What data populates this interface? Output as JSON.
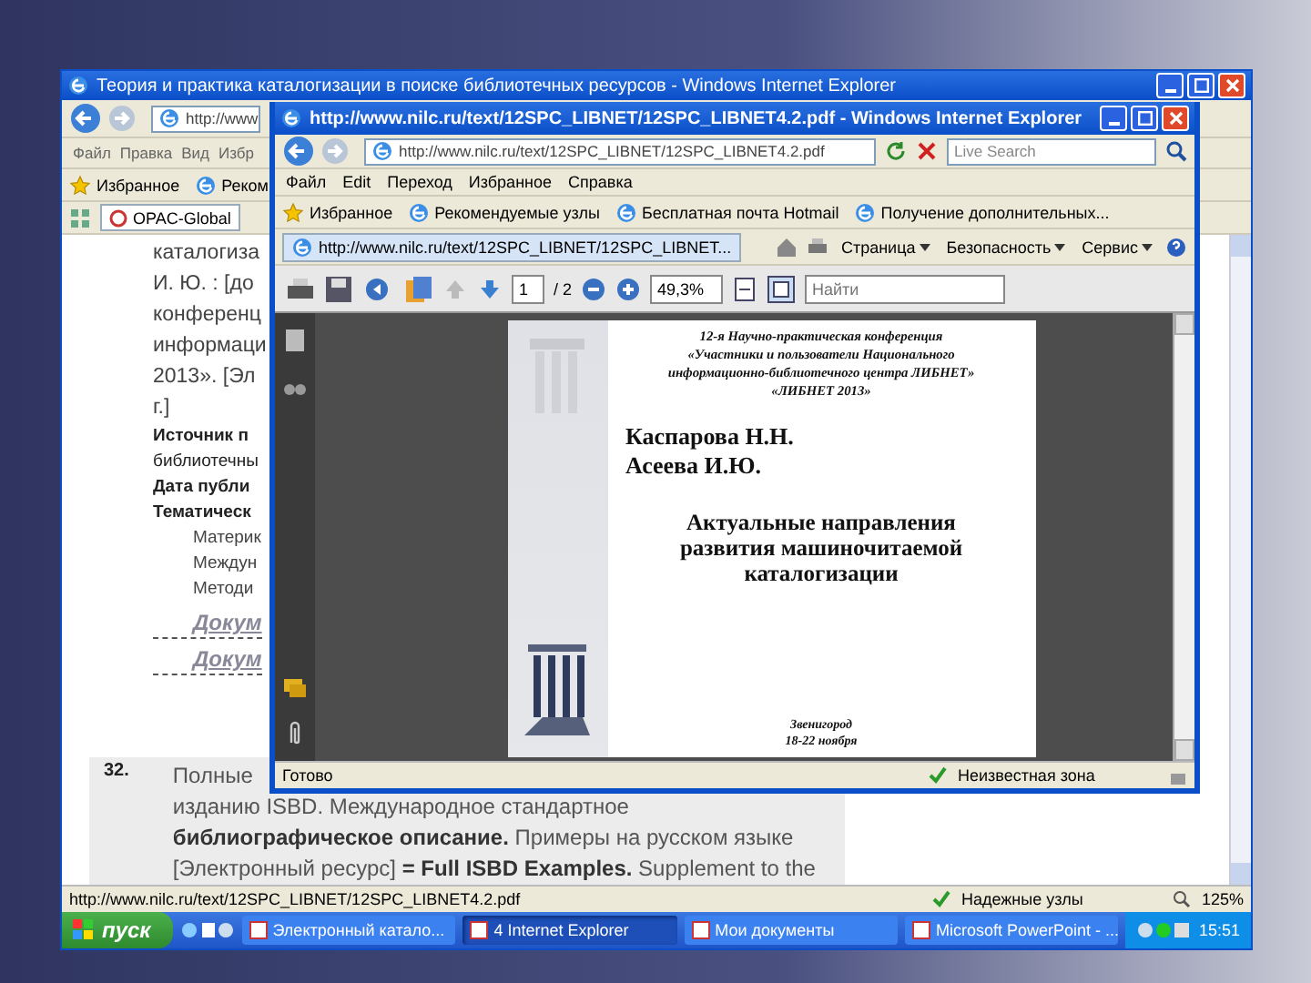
{
  "back_window": {
    "title": "Теория и практика каталогизации в поиске библиотечных ресурсов - Windows Internet Explorer",
    "address": "http://www",
    "menu": [
      "Файл",
      "Правка",
      "Вид",
      "Избр"
    ],
    "favorites": [
      "Избранное",
      "Реком"
    ],
    "tab": "OPAC-Global",
    "content": {
      "fragments": [
        {
          "kind": "large",
          "text": "каталогиза"
        },
        {
          "kind": "large",
          "text": "И. Ю. : [до"
        },
        {
          "kind": "large",
          "text": "конференц"
        },
        {
          "kind": "large",
          "text": "информаци"
        },
        {
          "kind": "large",
          "text": "2013». [Эл"
        },
        {
          "kind": "large",
          "text": "г.]"
        },
        {
          "kind": "bold",
          "text": "Источник п"
        },
        {
          "kind": "plain",
          "text": "библиотечны"
        },
        {
          "kind": "bold",
          "text": "Дата публи"
        },
        {
          "kind": "bold",
          "text": "Тематическ"
        },
        {
          "kind": "indent",
          "text": "Материк"
        },
        {
          "kind": "indent",
          "text": "Междун"
        },
        {
          "kind": "indent",
          "text": "Методи"
        },
        {
          "kind": "link",
          "text": "Докум"
        },
        {
          "kind": "link",
          "text": "Докум"
        }
      ],
      "entry_number": "32.",
      "entry_lines": [
        "Полные",
        "изданию ISBD. Международное стандартное",
        "**библиографическое описание.** Примеры на русском языке",
        "[Электронный ресурс] **= Full ISBD Examples.** Supplement to the"
      ]
    },
    "status": {
      "url": "http://www.nilc.ru/text/12SPC_LIBNET/12SPC_LIBNET4.2.pdf",
      "zone": "Надежные узлы",
      "zoom": "125%"
    }
  },
  "front_window": {
    "title": "http://www.nilc.ru/text/12SPC_LIBNET/12SPC_LIBNET4.2.pdf - Windows Internet Explorer",
    "address": "http://www.nilc.ru/text/12SPC_LIBNET/12SPC_LIBNET4.2.pdf",
    "search_placeholder": "Live Search",
    "menu": [
      "Файл",
      "Edit",
      "Переход",
      "Избранное",
      "Справка"
    ],
    "favorites": [
      "Избранное",
      "Рекомендуемые узлы",
      "Бесплатная почта Hotmail",
      "Получение дополнительных..."
    ],
    "tab": "http://www.nilc.ru/text/12SPC_LIBNET/12SPC_LIBNET...",
    "commands": [
      "Страница",
      "Безопасность",
      "Сервис"
    ],
    "pdf_toolbar": {
      "page": "1",
      "page_count": "/ 2",
      "zoom": "49,3%",
      "find_placeholder": "Найти"
    },
    "document": {
      "header_lines": [
        "12-я Научно-практическая конференция",
        "«Участники и пользователи Национального",
        "информационно-библиотечного центра ЛИБНЕТ»",
        "«ЛИБНЕТ 2013»"
      ],
      "authors": [
        "Каспарова Н.Н.",
        "Асеева И.Ю."
      ],
      "title_lines": [
        "Актуальные направления",
        "развития машиночитаемой",
        "каталогизации"
      ],
      "place": "Звенигород",
      "dates": "18-22 ноября"
    },
    "status": {
      "text": "Готово",
      "zone": "Неизвестная зона"
    }
  },
  "taskbar": {
    "start": "пуск",
    "tasks": [
      {
        "label": "Электронный катало...",
        "selected": false
      },
      {
        "label": "4 Internet Explorer",
        "selected": true
      },
      {
        "label": "Мои документы",
        "selected": false
      },
      {
        "label": "Microsoft PowerPoint - ...",
        "selected": false
      }
    ],
    "clock": "15:51"
  }
}
